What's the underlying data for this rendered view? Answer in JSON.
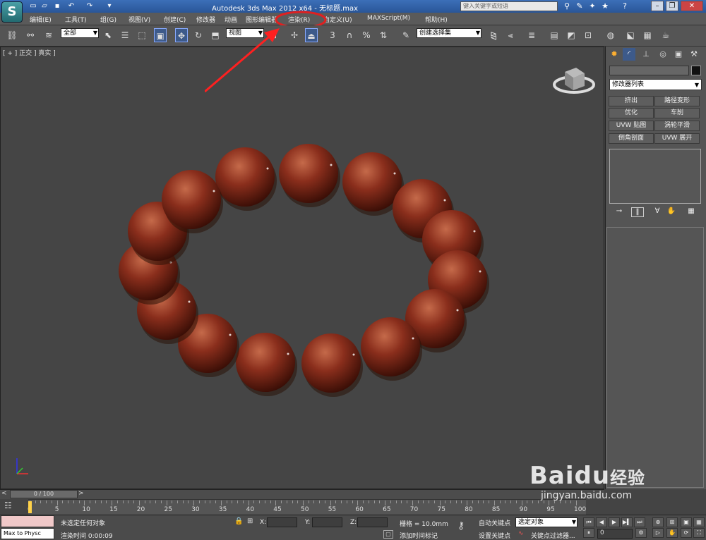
{
  "window": {
    "title": "Autodesk 3ds Max  2012 x64 - 无标题.max",
    "search_placeholder": "键入关键字或短语",
    "logo_glyph": "S"
  },
  "menu": [
    "编辑(E)",
    "工具(T)",
    "组(G)",
    "视图(V)",
    "创建(C)",
    "修改器",
    "动画",
    "图形编辑器",
    "渲染(R)",
    "自定义(U)",
    "MAXScript(M)",
    "帮助(H)"
  ],
  "toolbar": {
    "selection_filter": "全部",
    "ref_coord": "视图",
    "named_selection": "创建选择集",
    "snap_angle_label": "3"
  },
  "viewport": {
    "label": "[ + ] 正交 ] 真实 ]",
    "accent": "#ff3333",
    "bead_color": "#8a2e1c"
  },
  "command_panel": {
    "modifier_list": "修改器列表",
    "modifier_buttons": [
      "挤出",
      "路径变形",
      "优化",
      "车削",
      "UVW 贴图",
      "涡轮平滑",
      "倒角剖面",
      "UVW 展开"
    ]
  },
  "timeline": {
    "frame_counter": "0 / 100",
    "ticks": [
      "0",
      "5",
      "10",
      "15",
      "20",
      "25",
      "30",
      "35",
      "40",
      "45",
      "50",
      "55",
      "60",
      "65",
      "70",
      "75",
      "80",
      "85",
      "90",
      "95",
      "100"
    ]
  },
  "status": {
    "maxscript": "Max to Physc",
    "selection": "未选定任何对象",
    "render_time": "渲染时间  0:00:09",
    "x_label": "X:",
    "y_label": "Y:",
    "z_label": "Z:",
    "grid": "栅格 = 10.0mm",
    "add_time_tag": "添加时间标记",
    "auto_key": "自动关键点",
    "set_key": "设置关键点",
    "selected_object": "选定对象",
    "key_filters": "关键点过滤器...",
    "current_frame": "0"
  },
  "watermark": {
    "brand": "Baidu",
    "brand_cn": "经验",
    "url": "jingyan.baidu.com"
  }
}
